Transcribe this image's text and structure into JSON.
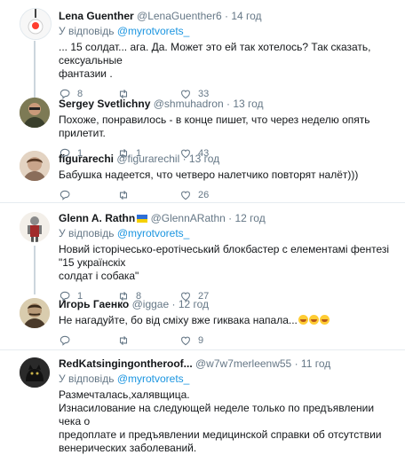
{
  "reply_prefix": "У відповідь",
  "dot": "·",
  "tweets": [
    {
      "name": "Lena Guenther",
      "handle": "@LenaGuenther6",
      "time": "14 год",
      "reply_to": "@myrotvorets_",
      "lines": [
        "... 15 солдат... ага. Да. Может это ей так хотелось? Так сказать, сексуальные",
        "фантазии ."
      ],
      "replies": "8",
      "retweets": "",
      "likes": "33"
    },
    {
      "name": "Sergey Svetlichny",
      "handle": "@shmuhadron",
      "time": "13 год",
      "lines": [
        "Похоже, понравилось - в конце пишет, что через неделю опять прилетит."
      ],
      "replies": "1",
      "retweets": "1",
      "likes": "43"
    },
    {
      "name": "figurarechi",
      "handle": "@figurarechil",
      "time": "13 год",
      "lines": [
        "Бабушка надеется, что четверо налетчико повторят налёт)))"
      ],
      "replies": "",
      "retweets": "",
      "likes": "26"
    },
    {
      "name": "Glenn A. Rathn",
      "handle": "@GlennARathn",
      "time": "12 год",
      "reply_to": "@myrotvorets_",
      "lines": [
        "Новий історічесько-еротічеський блокбастер с елементамі фентезі \"15 українскіх",
        "солдат і собака\""
      ],
      "replies": "1",
      "retweets": "8",
      "likes": "27"
    },
    {
      "name": "Игорь Гаенко",
      "handle": "@iggae",
      "time": "12 год",
      "lines": [
        "Не нагадуйте, бо від сміху вже гиквака напала..."
      ],
      "replies": "",
      "retweets": "",
      "likes": "9"
    },
    {
      "name": "RedKatsingingontheroof...",
      "handle": "@w7w7merleenw55",
      "time": "11 год",
      "reply_to": "@myrotvorets_",
      "lines": [
        "Размечталась,халявщица.",
        "Изнасилование на следующей неделе только по предъявлении чека о",
        "предоплате и предъявлении медицинской справки об отсутствии",
        "венерических заболеваний."
      ],
      "replies": "",
      "retweets": "",
      "likes": ""
    }
  ]
}
